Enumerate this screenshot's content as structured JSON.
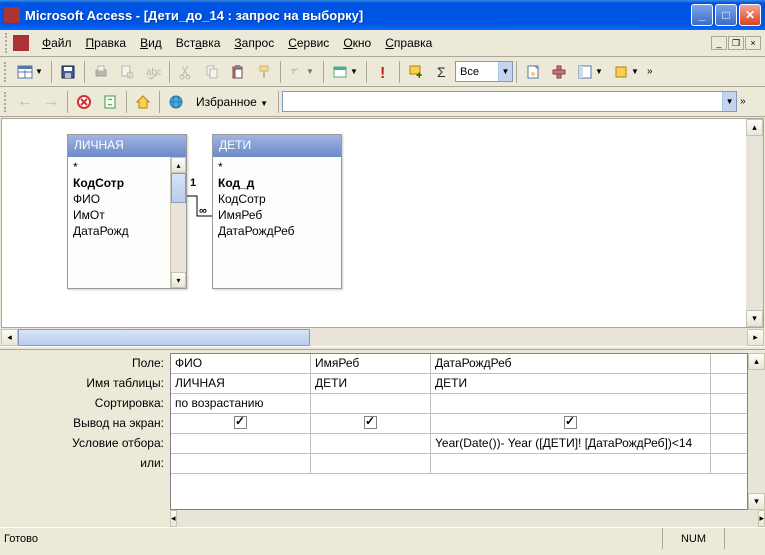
{
  "title": "Microsoft Access - [Дети_до_14 : запрос на выборку]",
  "menu": [
    "Файл",
    "Правка",
    "Вид",
    "Вставка",
    "Запрос",
    "Сервис",
    "Окно",
    "Справка"
  ],
  "toolbar2": {
    "favorites": "Избранное"
  },
  "combo_vse": "Все",
  "tables": {
    "t1": {
      "title": "ЛИЧНАЯ",
      "fields": [
        "*",
        "КодСотр",
        "ФИО",
        "ИмОт",
        "ДатаРожд"
      ]
    },
    "t2": {
      "title": "ДЕТИ",
      "fields": [
        "*",
        "Код_д",
        "КодСотр",
        "ИмяРеб",
        "ДатаРождРеб"
      ]
    }
  },
  "join": {
    "left": "1",
    "right": "∞"
  },
  "grid": {
    "labels": [
      "Поле:",
      "Имя таблицы:",
      "Сортировка:",
      "Вывод на экран:",
      "Условие отбора:",
      "или:"
    ],
    "cols": [
      {
        "field": "ФИО",
        "table": "ЛИЧНАЯ",
        "sort": "по возрастанию",
        "show": true,
        "criteria": ""
      },
      {
        "field": "ИмяРеб",
        "table": "ДЕТИ",
        "sort": "",
        "show": true,
        "criteria": ""
      },
      {
        "field": "ДатаРождРеб",
        "table": "ДЕТИ",
        "sort": "",
        "show": true,
        "criteria": "Year(Date())- Year ([ДЕТИ]! [ДатаРождРеб])<14"
      }
    ]
  },
  "status": {
    "ready": "Готово",
    "num": "NUM"
  }
}
